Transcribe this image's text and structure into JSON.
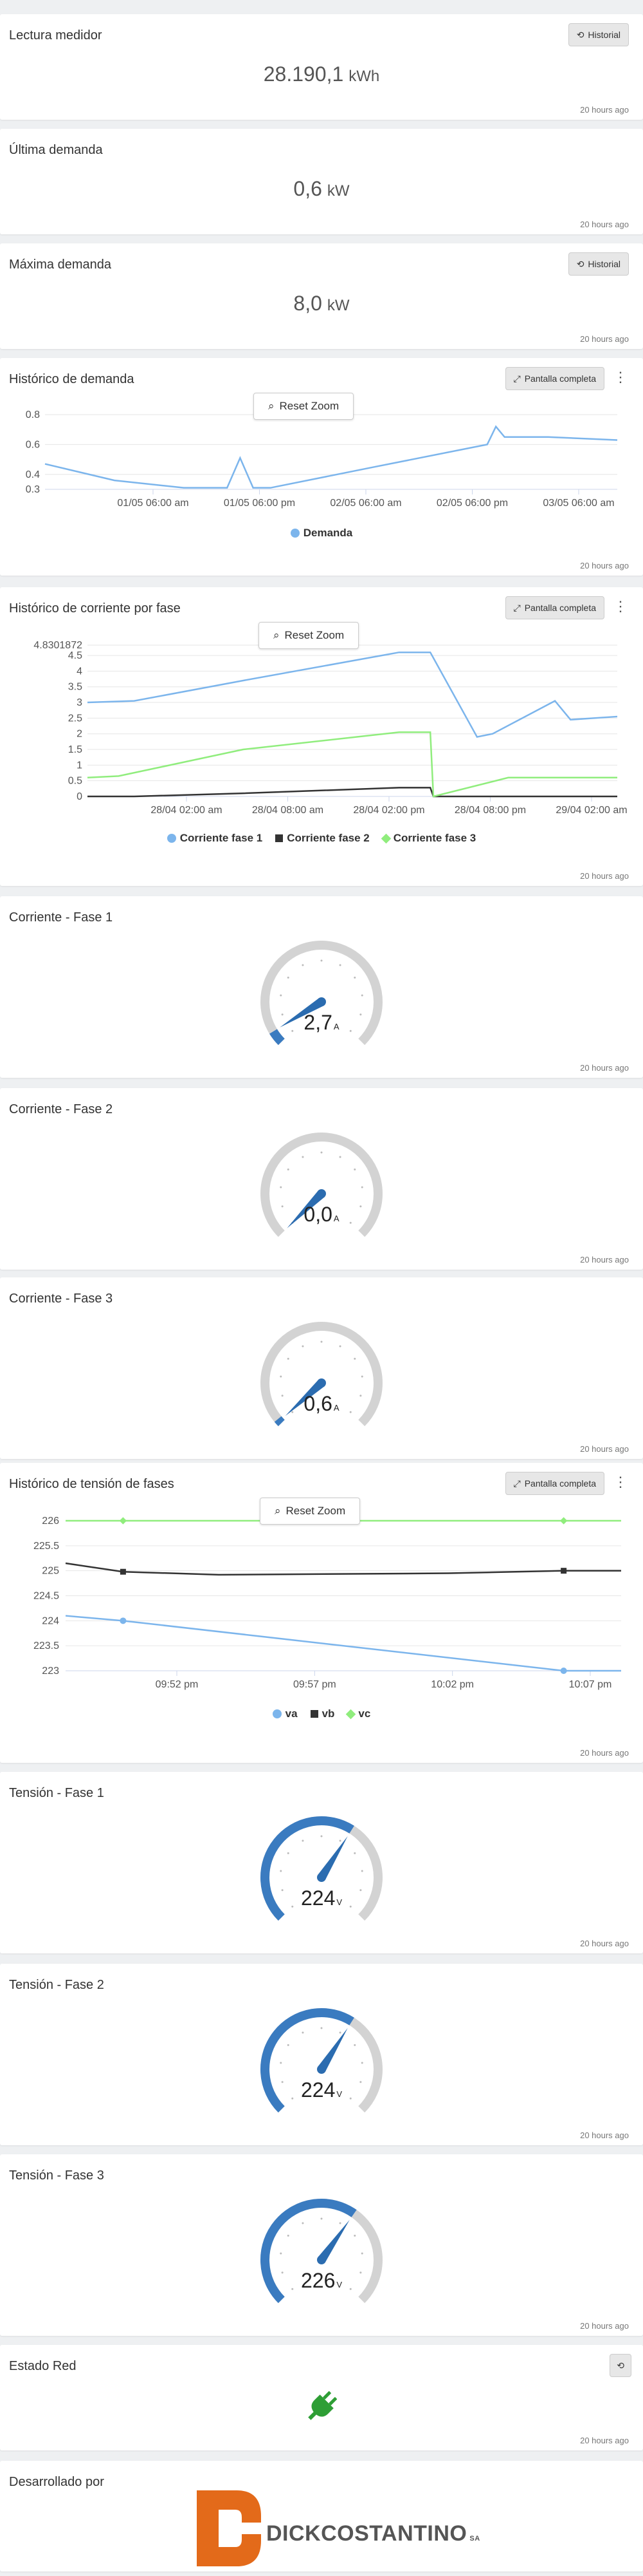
{
  "common": {
    "updated": "20 hours ago",
    "historial": "Historial",
    "fullscreen": "Pantalla completa",
    "reset_zoom": "Reset Zoom"
  },
  "lectura": {
    "title": "Lectura medidor",
    "value": "28.190,1",
    "unit": "kWh"
  },
  "ultima": {
    "title": "Última demanda",
    "value": "0,6",
    "unit": "kW"
  },
  "maxima": {
    "title": "Máxima demanda",
    "value": "8,0",
    "unit": "kW"
  },
  "hist_demanda": {
    "title": "Histórico de demanda",
    "chart_data": {
      "type": "line",
      "yticks": [
        "0.8",
        "0.6",
        "0.4",
        "0.3"
      ],
      "ylim": [
        0.3,
        0.8
      ],
      "xticks": [
        "01/05 06:00 am",
        "01/05 06:00 pm",
        "02/05 06:00 am",
        "02/05 06:00 pm",
        "03/05 06:00 am"
      ],
      "series": [
        {
          "name": "Demanda",
          "color": "#7cb5ec",
          "x": [
            0,
            8,
            16,
            21,
            22.5,
            24,
            26,
            38,
            51,
            52,
            53,
            58,
            66
          ],
          "y": [
            0.47,
            0.36,
            0.31,
            0.31,
            0.51,
            0.31,
            0.31,
            0.45,
            0.6,
            0.72,
            0.65,
            0.65,
            0.63
          ]
        }
      ]
    }
  },
  "hist_corriente": {
    "title": "Histórico de corriente por fase",
    "chart_data": {
      "type": "line",
      "ylim": [
        0,
        4.8301872
      ],
      "yticks": [
        "4.8301872",
        "4.5",
        "4",
        "3.5",
        "3",
        "2.5",
        "2",
        "1.5",
        "1",
        "0.5",
        "0"
      ],
      "xticks": [
        "28/04 02:00 am",
        "28/04 08:00 am",
        "28/04 02:00 pm",
        "28/04 08:00 pm",
        "29/04 02:00 am"
      ],
      "series": [
        {
          "name": "Corriente fase 1",
          "color": "#7cb5ec",
          "x": [
            0,
            3,
            10,
            20,
            22,
            25,
            26,
            30,
            31,
            34
          ],
          "y": [
            3.0,
            3.05,
            3.7,
            4.6,
            4.6,
            1.9,
            2.0,
            3.05,
            2.45,
            2.55
          ]
        },
        {
          "name": "Corriente fase 2",
          "color": "#333333",
          "x": [
            0,
            3,
            10,
            20,
            22,
            22.2,
            34
          ],
          "y": [
            0,
            0,
            0.1,
            0.28,
            0.28,
            0,
            0
          ]
        },
        {
          "name": "Corriente fase 3",
          "color": "#90ed7d",
          "x": [
            0,
            2,
            10,
            20,
            22,
            22.2,
            27,
            34
          ],
          "y": [
            0.6,
            0.65,
            1.5,
            2.05,
            2.05,
            0,
            0.6,
            0.6
          ]
        }
      ]
    }
  },
  "gauge_c1": {
    "title": "Corriente - Fase 1",
    "value": "2,7",
    "unit": "A",
    "level": 0.05
  },
  "gauge_c2": {
    "title": "Corriente - Fase 2",
    "value": "0,0",
    "unit": "A",
    "level": 0
  },
  "gauge_c3": {
    "title": "Corriente - Fase 3",
    "value": "0,6",
    "unit": "A",
    "level": 0.01
  },
  "hist_tension": {
    "title": "Histórico de tensión de fases",
    "chart_data": {
      "type": "line",
      "ylim": [
        223,
        226
      ],
      "yticks": [
        "226",
        "225.5",
        "225",
        "224.5",
        "224",
        "223.5",
        "223"
      ],
      "xticks": [
        "09:52 pm",
        "09:57 pm",
        "10:02 pm",
        "10:07 pm"
      ],
      "series": [
        {
          "name": "va",
          "color": "#7cb5ec",
          "x": [
            0,
            3,
            26,
            29
          ],
          "y": [
            224.1,
            224.0,
            223.0,
            223.0
          ]
        },
        {
          "name": "vb",
          "color": "#333333",
          "x": [
            0,
            3,
            8,
            20,
            26,
            29
          ],
          "y": [
            225.15,
            224.98,
            224.92,
            224.95,
            225.0,
            225.0
          ]
        },
        {
          "name": "vc",
          "color": "#90ed7d",
          "x": [
            0,
            3,
            26,
            29
          ],
          "y": [
            226.0,
            226.0,
            226.0,
            226.0
          ]
        }
      ]
    }
  },
  "gauge_t1": {
    "title": "Tensión - Fase 1",
    "value": "224",
    "unit": "V",
    "level": 0.62
  },
  "gauge_t2": {
    "title": "Tensión - Fase 2",
    "value": "224",
    "unit": "V",
    "level": 0.62
  },
  "gauge_t3": {
    "title": "Tensión - Fase 3",
    "value": "226",
    "unit": "V",
    "level": 0.63
  },
  "estado": {
    "title": "Estado Red",
    "icon": "plug-icon",
    "color": "#2e9e35"
  },
  "footer": {
    "title": "Desarrollado por",
    "brand": "DICKCOSTANTINO",
    "brand_suffix": "SA",
    "logo_color": "#e36a1a"
  }
}
